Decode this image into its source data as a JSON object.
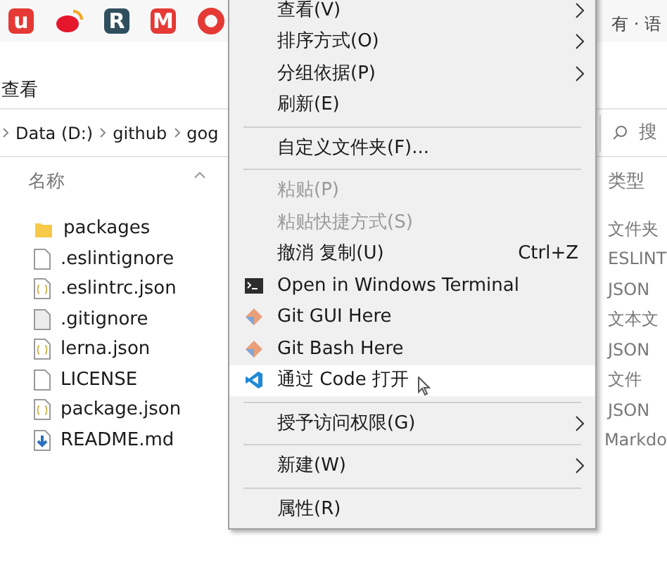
{
  "bookmarks": [
    {
      "kind": "letter",
      "label": "u",
      "color": "#e53935"
    },
    {
      "kind": "weibo",
      "color": "#e6162d"
    },
    {
      "kind": "letter",
      "label": "R",
      "color": "#2f4f5f"
    },
    {
      "kind": "letter",
      "label": "M",
      "color": "#e53935"
    },
    {
      "kind": "ring",
      "color": "#e53935"
    }
  ],
  "tab_title": "有 · 语",
  "toolbar": {
    "items": [
      "查看"
    ]
  },
  "address_bar": {
    "crumbs": [
      "Data (D:)",
      "github",
      "gog"
    ],
    "search_placeholder": "搜"
  },
  "columns": [
    "名称",
    "类型"
  ],
  "files": [
    {
      "name": "packages",
      "type": "文件夹",
      "kind": "folder"
    },
    {
      "name": ".eslintignore",
      "type": "ESLINT",
      "kind": "file"
    },
    {
      "name": ".eslintrc.json",
      "type": "JSON",
      "kind": "json"
    },
    {
      "name": ".gitignore",
      "type": "文本文",
      "kind": "text"
    },
    {
      "name": "lerna.json",
      "type": "JSON",
      "kind": "json"
    },
    {
      "name": "LICENSE",
      "type": "文件",
      "kind": "file"
    },
    {
      "name": "package.json",
      "type": "JSON",
      "kind": "json"
    },
    {
      "name": "README.md",
      "type": "Markdo",
      "kind": "markdown"
    }
  ],
  "context_menu": {
    "items": [
      {
        "kind": "item",
        "label": "查看(V)",
        "submenu": true,
        "disabled": false,
        "selected": false
      },
      {
        "kind": "item",
        "label": "排序方式(O)",
        "submenu": true,
        "disabled": false,
        "selected": false
      },
      {
        "kind": "item",
        "label": "分组依据(P)",
        "submenu": true,
        "disabled": false,
        "selected": false
      },
      {
        "kind": "item",
        "label": "刷新(E)",
        "submenu": false,
        "disabled": false,
        "selected": false
      },
      {
        "kind": "separator"
      },
      {
        "kind": "item",
        "label": "自定义文件夹(F)...",
        "submenu": false,
        "disabled": false,
        "selected": false
      },
      {
        "kind": "separator"
      },
      {
        "kind": "item",
        "label": "粘贴(P)",
        "submenu": false,
        "disabled": true,
        "selected": false
      },
      {
        "kind": "item",
        "label": "粘贴快捷方式(S)",
        "submenu": false,
        "disabled": true,
        "selected": false
      },
      {
        "kind": "item",
        "label": "撤消 复制(U)",
        "shortcut": "Ctrl+Z",
        "submenu": false,
        "disabled": false,
        "selected": false
      },
      {
        "kind": "terminal",
        "label": "Open in Windows Terminal",
        "submenu": false,
        "disabled": false,
        "selected": false
      },
      {
        "kind": "git",
        "label": "Git GUI Here",
        "submenu": false,
        "disabled": false,
        "selected": false
      },
      {
        "kind": "git",
        "label": "Git Bash Here",
        "submenu": false,
        "disabled": false,
        "selected": false
      },
      {
        "kind": "vscode",
        "label": "通过 Code 打开",
        "submenu": false,
        "disabled": false,
        "selected": true
      },
      {
        "kind": "separator"
      },
      {
        "kind": "item",
        "label": "授予访问权限(G)",
        "submenu": true,
        "disabled": false,
        "selected": false
      },
      {
        "kind": "separator"
      },
      {
        "kind": "item",
        "label": "新建(W)",
        "submenu": true,
        "disabled": false,
        "selected": false
      },
      {
        "kind": "separator"
      },
      {
        "kind": "item",
        "label": "属性(R)",
        "submenu": false,
        "disabled": false,
        "selected": false
      }
    ]
  }
}
